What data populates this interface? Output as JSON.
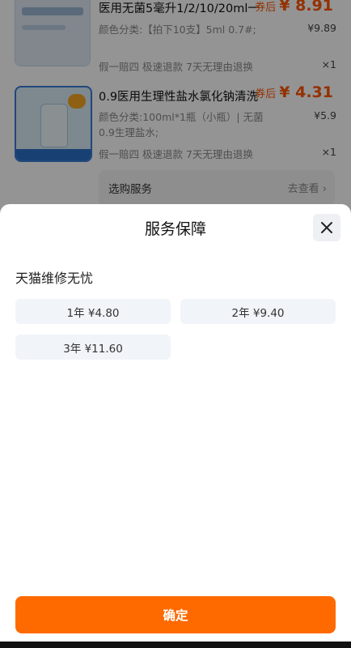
{
  "products": [
    {
      "title": "医用无菌5毫升1/2/10/20ml一",
      "coupon_label": "券后",
      "coupon_price": "¥ 8.91",
      "spec": "颜色分类:【拍下10支】5ml 0.7#;",
      "price": "¥9.89",
      "promo": "假一赔四  极速退款  7天无理由退换",
      "qty": "×1"
    },
    {
      "title": "0.9医用生理性盐水氯化钠清洗",
      "coupon_label": "券后",
      "coupon_price": "¥ 4.31",
      "spec": "颜色分类:100ml*1瓶（小瓶）| 无菌0.9生理盐水;",
      "price": "¥5.9",
      "promo": "假一赔四  极速退款  7天无理由退换",
      "qty": "×1"
    }
  ],
  "service_row": {
    "label": "选购服务",
    "more": "去查看"
  },
  "sheet": {
    "title": "服务保障",
    "section_title": "天猫维修无忧",
    "options": [
      {
        "label": "1年 ¥4.80"
      },
      {
        "label": "2年 ¥9.40"
      },
      {
        "label": "3年 ¥11.60"
      }
    ],
    "confirm_label": "确定"
  },
  "colors": {
    "accent": "#ff6a00",
    "coupon": "#ff5500",
    "option_bg": "#f1f4f8"
  }
}
